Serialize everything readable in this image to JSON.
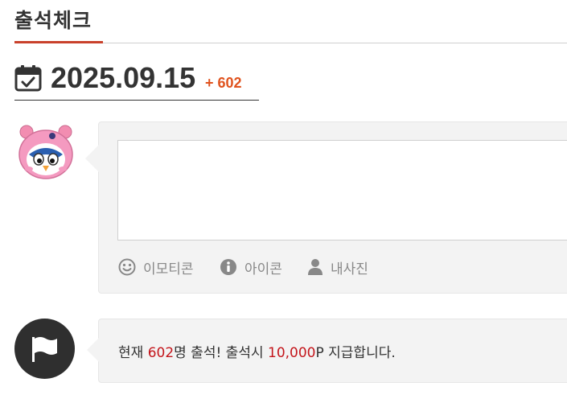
{
  "header": {
    "title": "출석체크"
  },
  "date": {
    "value": "2025.09.15",
    "count": "+ 602"
  },
  "comment": {
    "textarea_value": "",
    "tools": [
      {
        "label": "이모티콘",
        "icon": "smile-icon"
      },
      {
        "label": "아이콘",
        "icon": "info-icon"
      },
      {
        "label": "내사진",
        "icon": "user-icon"
      }
    ]
  },
  "notice": {
    "prefix": "현재 ",
    "count": "602",
    "mid": "명 출석! 출석시 ",
    "points": "10,000",
    "suffix": "P 지급합니다."
  },
  "colors": {
    "accent": "#c9412b",
    "count_orange": "#e0531e",
    "highlight_red": "#c4161c",
    "panel_bg": "#f3f3f3",
    "flag_bg": "#2f2f2f"
  }
}
